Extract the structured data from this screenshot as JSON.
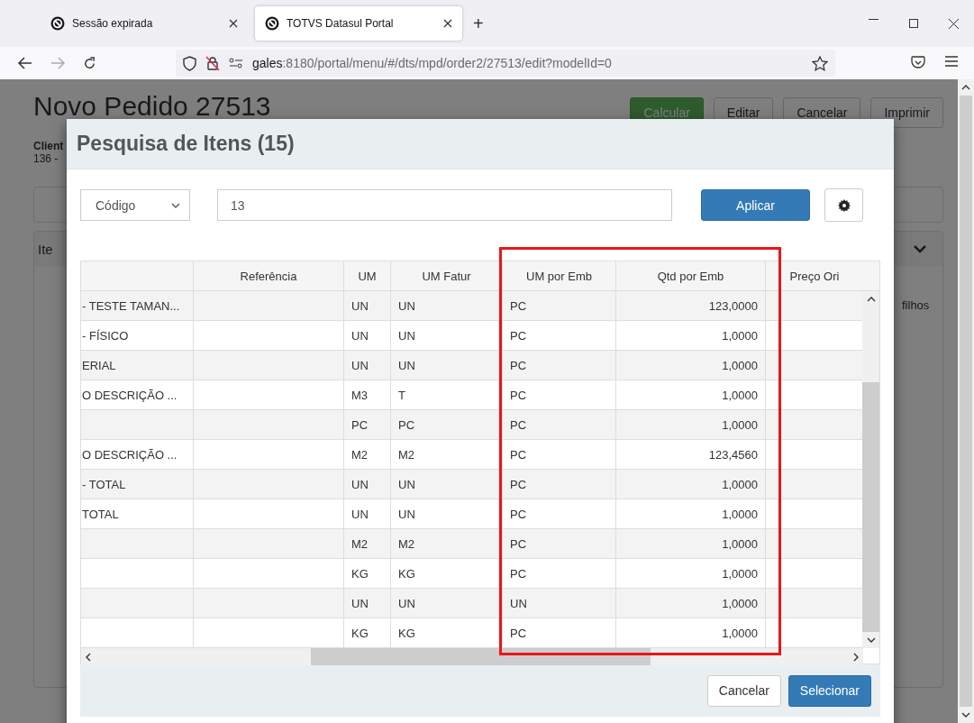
{
  "browser": {
    "tabs": [
      {
        "title": "Sessão expirada",
        "selected": false
      },
      {
        "title": "TOTVS Datasul Portal",
        "selected": true
      }
    ],
    "new_tab": "+",
    "url": {
      "host": "gales",
      "path": ":8180/portal/menu/#/dts/mpd/order2/27513/edit?modelId=0"
    }
  },
  "page": {
    "title": "Novo Pedido 27513",
    "customer_label": "Client",
    "customer_value": "136 -",
    "toolbar": [
      {
        "label": "Calcular",
        "kind": "success"
      },
      {
        "label": "Editar",
        "kind": "default"
      },
      {
        "label": "Cancelar",
        "kind": "default"
      },
      {
        "label": "Imprimir",
        "kind": "default"
      }
    ],
    "section_title": "Ite",
    "side_text": "filhos"
  },
  "modal": {
    "title": "Pesquisa de Itens (15)",
    "filter": "Código",
    "search_value": "13",
    "apply": "Aplicar",
    "columns": [
      "Referência",
      "UM",
      "UM Fatur",
      "UM por Emb",
      "Qtd por Emb",
      "Preço Ori"
    ],
    "rows": [
      {
        "column_1": "- TESTE TAMAN...",
        "um": "UN",
        "um_fatur": "UN",
        "um_por_emb": "PC",
        "qtd_por_emb": "123,0000"
      },
      {
        "column_1": "- FÍSICO",
        "um": "UN",
        "um_fatur": "UN",
        "um_por_emb": "PC",
        "qtd_por_emb": "1,0000"
      },
      {
        "column_1": "ERIAL",
        "um": "UN",
        "um_fatur": "UN",
        "um_por_emb": "PC",
        "qtd_por_emb": "1,0000"
      },
      {
        "column_1": "O DESCRIÇÃO ...",
        "um": "M3",
        "um_fatur": "T",
        "um_por_emb": "PC",
        "qtd_por_emb": "1,0000"
      },
      {
        "um": "PC",
        "um_fatur": "PC",
        "um_por_emb": "PC",
        "qtd_por_emb": "1,0000"
      },
      {
        "column_1": "O DESCRIÇÃO ...",
        "um": "M2",
        "um_fatur": "M2",
        "um_por_emb": "PC",
        "qtd_por_emb": "123,4560"
      },
      {
        "column_1": "- TOTAL",
        "um": "UN",
        "um_fatur": "UN",
        "um_por_emb": "PC",
        "qtd_por_emb": "1,0000"
      },
      {
        "column_1": "TOTAL",
        "um": "UN",
        "um_fatur": "UN",
        "um_por_emb": "PC",
        "qtd_por_emb": "1,0000"
      },
      {
        "um": "M2",
        "um_fatur": "M2",
        "um_por_emb": "PC",
        "qtd_por_emb": "1,0000"
      },
      {
        "um": "KG",
        "um_fatur": "KG",
        "um_por_emb": "PC",
        "qtd_por_emb": "1,0000"
      },
      {
        "um": "UN",
        "um_fatur": "UN",
        "um_por_emb": "UN",
        "qtd_por_emb": "1,0000"
      },
      {
        "um": "KG",
        "um_fatur": "KG",
        "um_por_emb": "PC",
        "qtd_por_emb": "1,0000"
      }
    ],
    "buttons": [
      {
        "label": "Cancelar",
        "kind": "default"
      },
      {
        "label": "Selecionar",
        "kind": "primary"
      }
    ]
  }
}
